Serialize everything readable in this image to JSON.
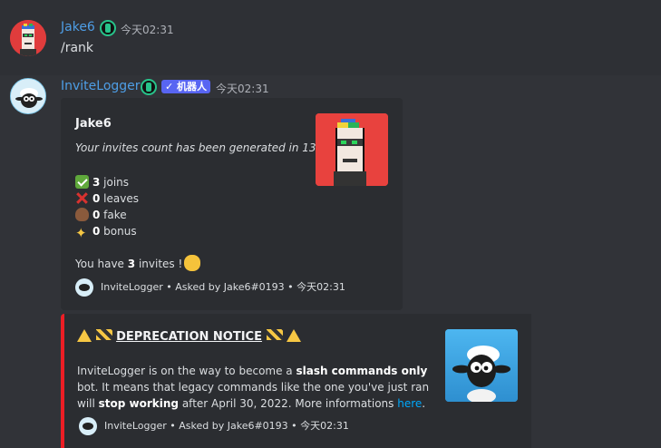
{
  "message1": {
    "username": "Jake6",
    "badge_icon": "active-developer-badge-icon",
    "timestamp": "今天02:31",
    "content": "/rank"
  },
  "message2": {
    "username": "InviteLogger",
    "badge_icon": "active-developer-badge-icon",
    "bot_tag": "✓ 机器人",
    "timestamp": "今天02:31"
  },
  "embed1": {
    "title": "Jake6",
    "subtitle": "Your invites count has been generated in 13ms",
    "stats": [
      {
        "icon": "check-mark-icon",
        "value": "3",
        "label": " joins"
      },
      {
        "icon": "cross-mark-icon",
        "value": "0",
        "label": " leaves"
      },
      {
        "icon": "poop-icon",
        "value": "0",
        "label": " fake"
      },
      {
        "icon": "sparkles-icon",
        "value": "0",
        "label": " bonus"
      }
    ],
    "total_prefix": "You have ",
    "total_value": "3",
    "total_suffix": " invites !",
    "footer": "InviteLogger • Asked by Jake6#0193 • 今天02:31"
  },
  "embed2": {
    "title_prefix": "⚠",
    "title": "DEPRECATION NOTICE",
    "body_1": "InviteLogger is on the way to become a ",
    "body_bold_1": "slash commands only",
    "body_2": " bot. It means that legacy commands like the one you've just ran will ",
    "body_bold_2": "stop working",
    "body_3": " after April 30, 2022. More informations ",
    "link_text": "here",
    "body_4": ".",
    "footer": "InviteLogger • Asked by Jake6#0193 • 今天02:31",
    "accent_color": "#ed1e25"
  },
  "colors": {
    "background": "#313338",
    "embed_bg": "#2b2d31",
    "username": "#4e9ee6",
    "bot_tag": "#5865f2",
    "link": "#00a8fc"
  }
}
